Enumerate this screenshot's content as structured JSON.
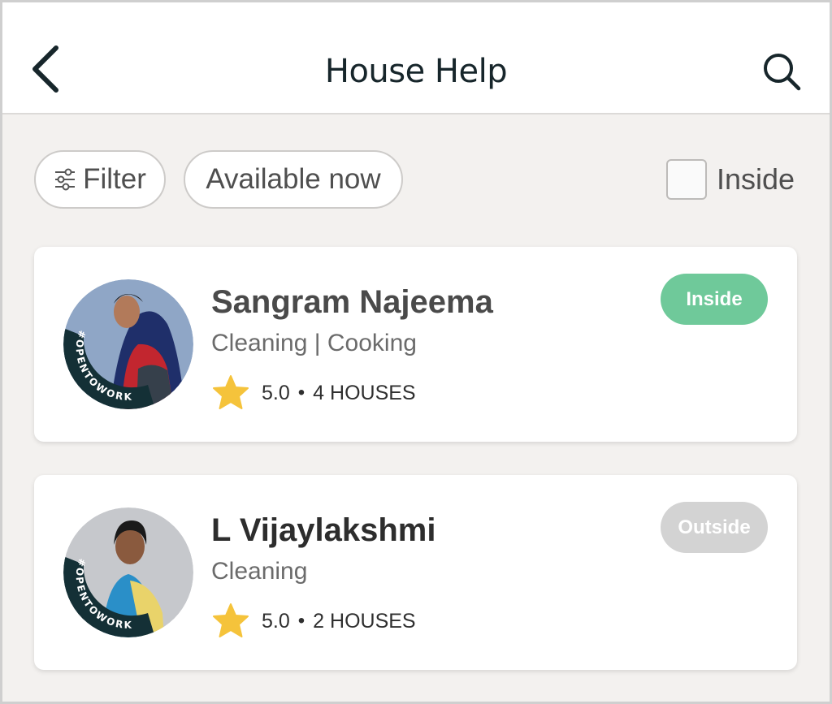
{
  "header": {
    "title": "House Help",
    "back_icon": "chevron-left-icon",
    "search_icon": "search-icon"
  },
  "filters": {
    "filter_label": "Filter",
    "filter_icon": "sliders-icon",
    "available_label": "Available now",
    "inside_label": "Inside",
    "inside_checked": false
  },
  "helpers": [
    {
      "name": "Sangram Najeema",
      "skills": "Cleaning | Cooking",
      "rating": "5.0",
      "houses": "4 HOUSES",
      "status": "Inside",
      "status_color": "#6fc99a",
      "avatar_badge": "#OPENTOWORK"
    },
    {
      "name": "L Vijaylakshmi",
      "skills": "Cleaning",
      "rating": "5.0",
      "houses": "2 HOUSES",
      "status": "Outside",
      "status_color": "#d3d3d3",
      "avatar_badge": "#OPENTOWORK"
    }
  ],
  "colors": {
    "accent_dark": "#17262b",
    "star": "#f5c33b",
    "background": "#f3f1ef"
  }
}
